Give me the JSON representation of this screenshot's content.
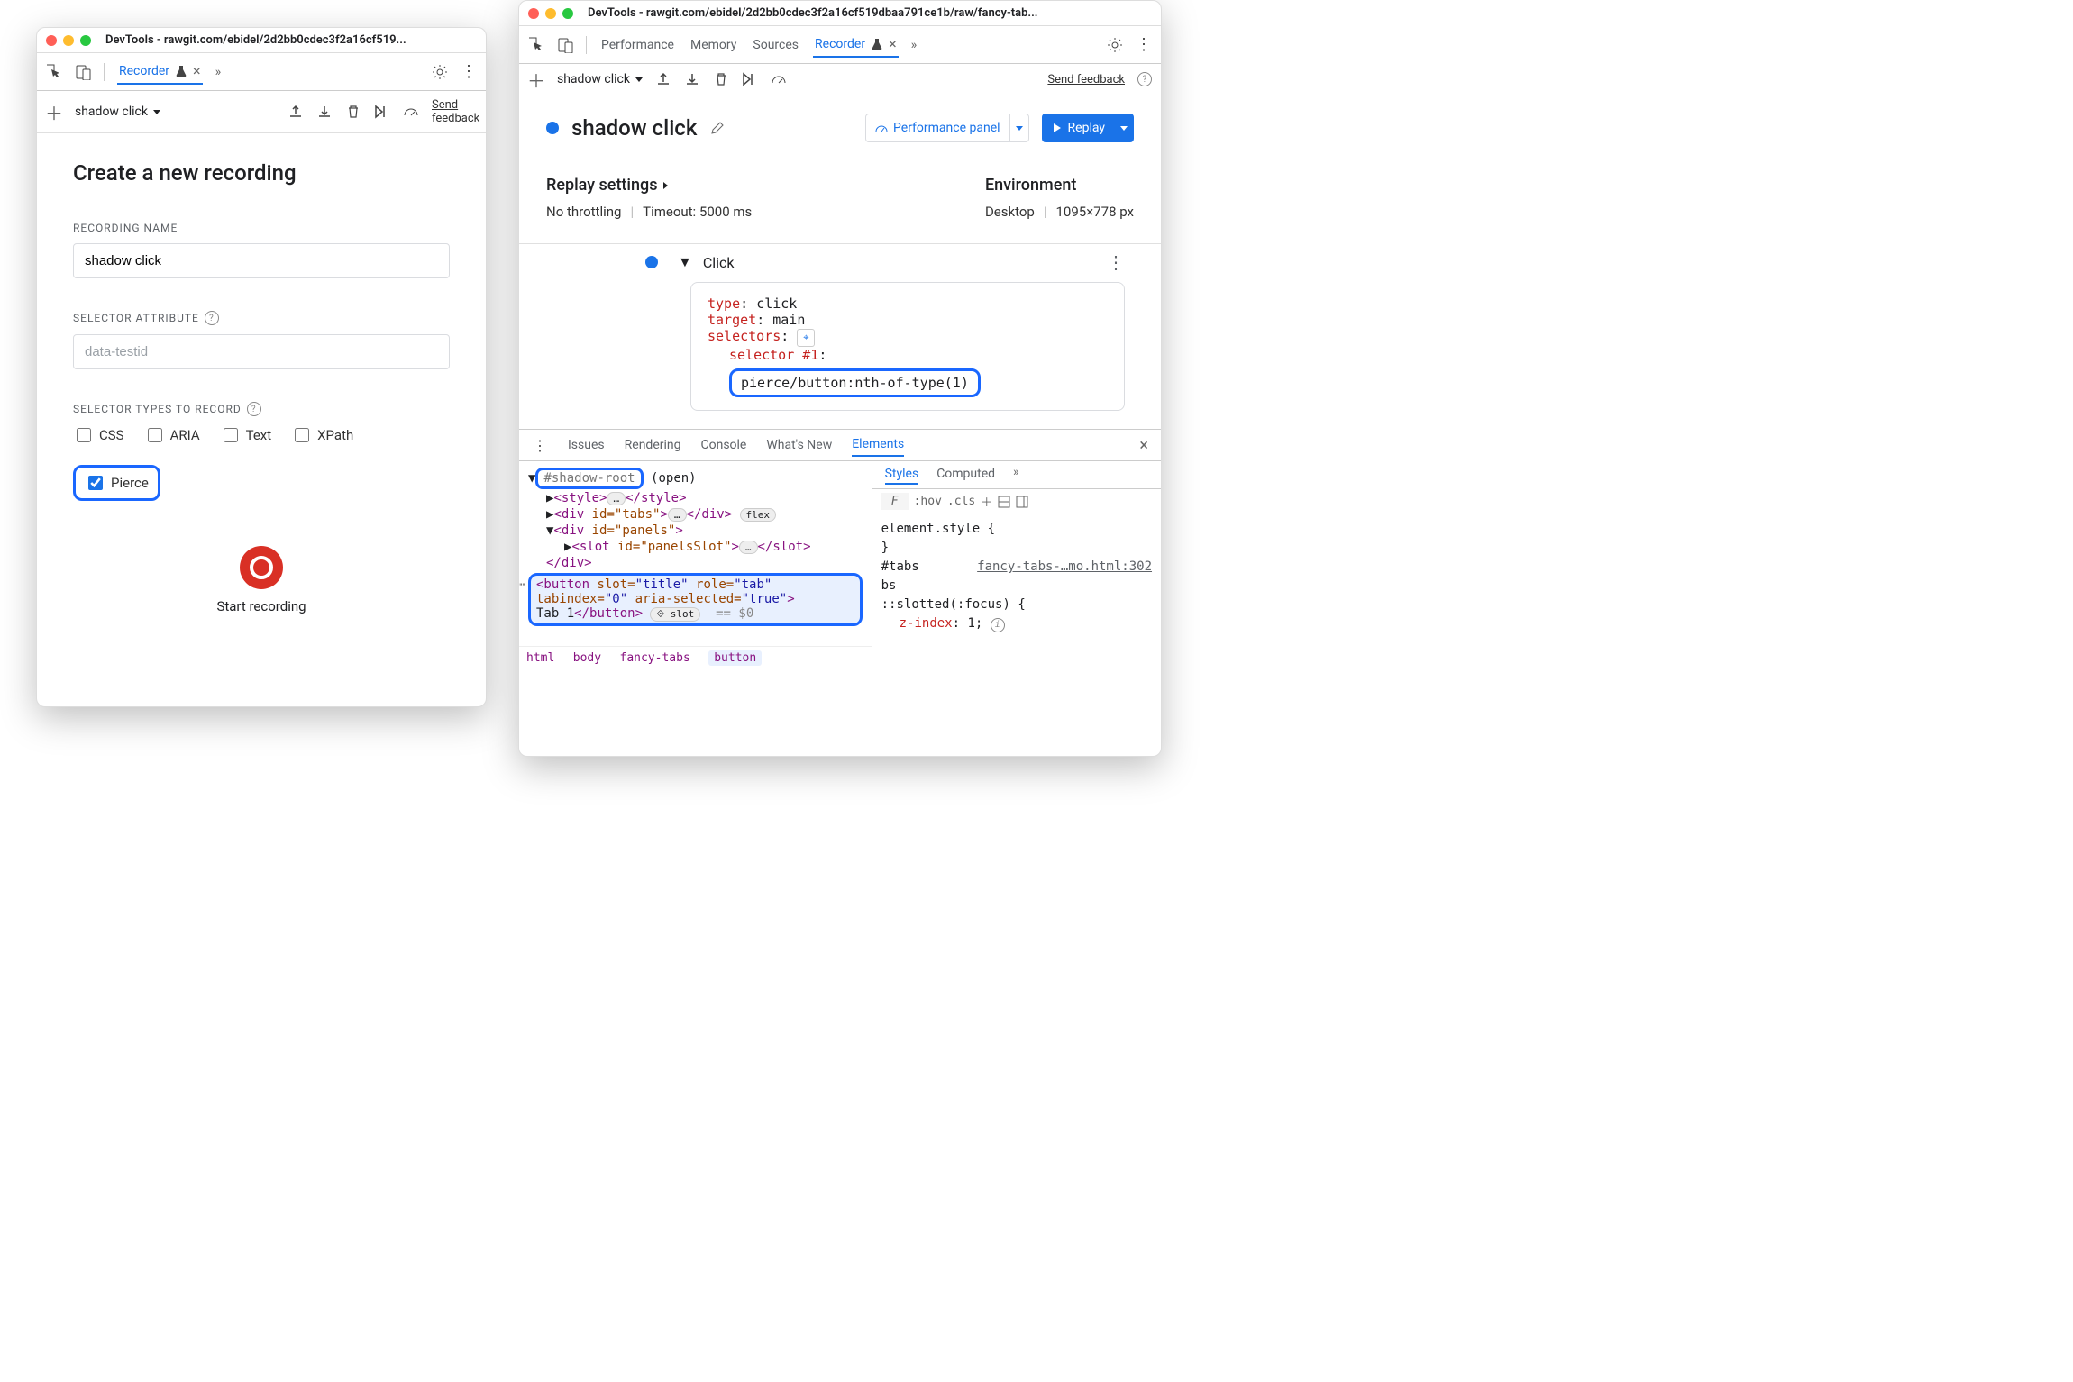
{
  "left": {
    "title": "DevTools - rawgit.com/ebidel/2d2bb0cdec3f2a16cf519...",
    "tab": "Recorder",
    "recording_dropdown": "shadow click",
    "send_feedback": "Send feedback",
    "heading": "Create a new recording",
    "lbl_name": "Recording Name",
    "name_value": "shadow click",
    "lbl_selector_attr": "Selector Attribute",
    "selector_attr_placeholder": "data-testid",
    "lbl_selector_types": "Selector Types to Record",
    "types": {
      "css": "CSS",
      "aria": "ARIA",
      "text": "Text",
      "xpath": "XPath",
      "pierce": "Pierce"
    },
    "start": "Start recording"
  },
  "right": {
    "title": "DevTools - rawgit.com/ebidel/2d2bb0cdec3f2a16cf519dbaa791ce1b/raw/fancy-tab...",
    "tabs": {
      "perf": "Performance",
      "mem": "Memory",
      "src": "Sources",
      "rec": "Recorder"
    },
    "recording_dropdown": "shadow click",
    "send_feedback": "Send feedback",
    "rec_title": "shadow click",
    "perf_panel": "Performance panel",
    "replay": "Replay",
    "settings_hdr": "Replay settings",
    "throttling": "No throttling",
    "timeout": "Timeout: 5000 ms",
    "env_hdr": "Environment",
    "env_device": "Desktop",
    "env_viewport": "1095×778 px",
    "step_name": "Click",
    "step": {
      "type_k": "type",
      "type_v": "click",
      "target_k": "target",
      "target_v": "main",
      "selectors_k": "selectors",
      "sel1_k": "selector #1",
      "sel1_v": "pierce/button:nth-of-type(1)"
    },
    "drawer_tabs": {
      "issues": "Issues",
      "rendering": "Rendering",
      "console": "Console",
      "wn": "What's New",
      "elements": "Elements"
    },
    "dom": {
      "shadowroot": "#shadow-root",
      "open": "(open)",
      "style": "style",
      "divtabs": "div",
      "tabs_attr": "id=\"tabs\"",
      "flex": "flex",
      "divpanels": "div",
      "panels_attr": "id=\"panels\"",
      "slot": "slot",
      "slot_attr": "id=\"panelsSlot\"",
      "button_open": "<button slot=\"title\" role=\"tab\" tabindex=\"0\" aria-selected=\"true\">",
      "button_text": "Tab 1",
      "slot_pill": "slot",
      "eq0": "== $0",
      "crumbs": [
        "html",
        "body",
        "fancy-tabs",
        "button"
      ]
    },
    "styles_tabs": {
      "styles": "Styles",
      "computed": "Computed"
    },
    "styles_tools": {
      "filter": "F",
      "hov": ":hov",
      "cls": ".cls"
    },
    "styles": {
      "rule1_sel": "element.style {",
      "rule1_close": "}",
      "rule2_sel": "#tabs",
      "rule2_src": "fancy-tabs-…mo.html:302",
      "rule2b": "::slotted(:focus) {",
      "rule2_prop": "z-index",
      "rule2_val": "1",
      "rule2_close": "}"
    }
  }
}
